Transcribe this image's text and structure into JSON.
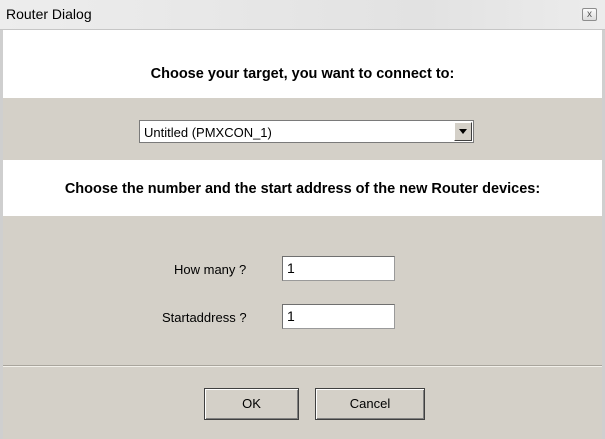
{
  "window": {
    "title": "Router Dialog",
    "close_glyph": "x"
  },
  "section1": {
    "heading": "Choose your target, you want to connect to:"
  },
  "target_select": {
    "selected": "Untitled (PMXCON_1)"
  },
  "section2": {
    "heading": "Choose the number and the start address of the new Router devices:"
  },
  "fields": {
    "how_many_label": "How many ?",
    "how_many_value": "1",
    "startaddress_label": "Startaddress ?",
    "startaddress_value": "1"
  },
  "buttons": {
    "ok_label": "OK",
    "cancel_label": "Cancel"
  },
  "colors": {
    "dialog_bg": "#d4d0c8",
    "band_bg": "#ffffff"
  }
}
